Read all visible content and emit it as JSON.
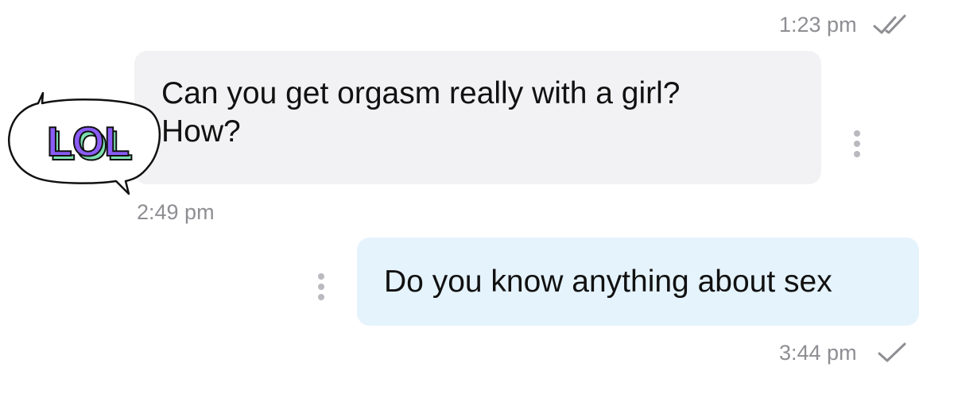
{
  "messages": [
    {
      "time": "1:23 pm",
      "status_icon": "double-check-icon"
    },
    {
      "direction": "incoming",
      "text": "Can you get orgasm really with a girl?\nHow?",
      "sticker_text": "LOL",
      "time": "2:49 pm"
    },
    {
      "direction": "outgoing",
      "text": "Do you know anything about sex",
      "time": "3:44 pm",
      "status_icon": "single-check-icon"
    }
  ],
  "colors": {
    "incoming_bubble": "#f2f2f4",
    "outgoing_bubble": "#e5f3fc",
    "timestamp": "#8e8e93",
    "sticker_fill": "#8b5cf6",
    "sticker_shadow": "#7ee0b0"
  }
}
